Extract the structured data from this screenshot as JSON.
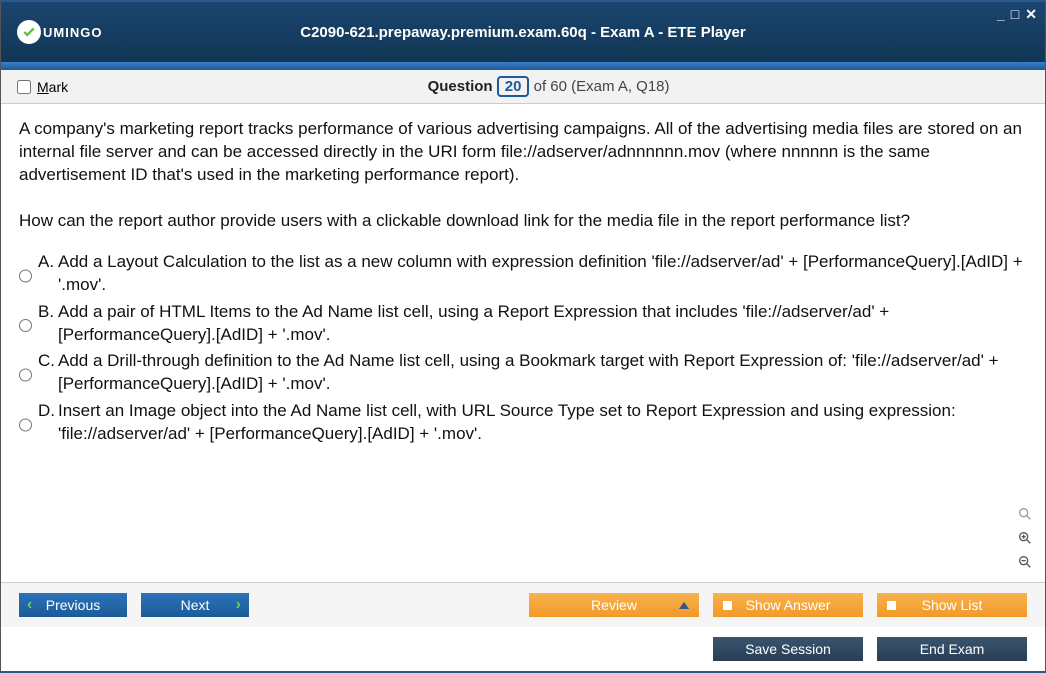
{
  "titlebar": {
    "logo_text": "UMINGO",
    "title": "C2090-621.prepaway.premium.exam.60q - Exam A - ETE Player"
  },
  "header": {
    "mark_label": "Mark",
    "q_label": "Question",
    "q_current": "20",
    "q_of": "of 60 (Exam A, Q18)"
  },
  "question": {
    "text_p1": "A company's marketing report tracks performance of various advertising campaigns. All of the advertising media files are stored on an internal file server and can be accessed directly in the URI form file://adserver/adnnnnnn.mov (where nnnnnn is the same advertisement ID that's used in the marketing performance report).",
    "text_p2": "How can the report author provide users with a clickable download link for the media file in the report performance list?",
    "options": [
      {
        "letter": "A.",
        "text": "Add a Layout Calculation to the list as a new column with expression definition 'file://adserver/ad' + [PerformanceQuery].[AdID] + '.mov'."
      },
      {
        "letter": "B.",
        "text": "Add a pair of HTML Items to the Ad Name list cell, using a Report Expression that includes 'file://adserver/ad' + [PerformanceQuery].[AdID] + '.mov'."
      },
      {
        "letter": "C.",
        "text": "Add a Drill-through definition to the Ad Name list cell, using a Bookmark target with Report Expression of: 'file://adserver/ad' + [PerformanceQuery].[AdID] + '.mov'."
      },
      {
        "letter": "D.",
        "text": "Insert an Image object into the Ad Name list cell, with URL Source Type set to Report Expression and using expression: 'file://adserver/ad' + [PerformanceQuery].[AdID] + '.mov'."
      }
    ]
  },
  "buttons": {
    "previous": "Previous",
    "next": "Next",
    "review": "Review",
    "show_answer": "Show Answer",
    "show_list": "Show List",
    "save_session": "Save Session",
    "end_exam": "End Exam"
  }
}
